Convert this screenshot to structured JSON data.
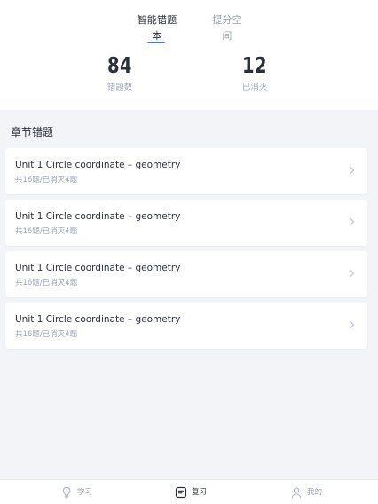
{
  "header": {
    "tabs": [
      {
        "label": "智能错题本",
        "active": true
      },
      {
        "label": "提分空间",
        "active": false
      }
    ],
    "stats": [
      {
        "value": "84",
        "label": "错题数"
      },
      {
        "value": "12",
        "label": "已消灭"
      }
    ]
  },
  "section": {
    "title": "章节错题"
  },
  "items": [
    {
      "title": "Unit 1  Circle coordinate – geometry",
      "subtitle": "共16题/已消灭4题"
    },
    {
      "title": "Unit 1  Circle coordinate – geometry",
      "subtitle": "共16题/已消灭4题"
    },
    {
      "title": "Unit 1  Circle coordinate – geometry",
      "subtitle": "共16题/已消灭4题"
    },
    {
      "title": "Unit 1  Circle coordinate – geometry",
      "subtitle": "共16题/已消灭4题"
    }
  ],
  "bottom_nav": [
    {
      "label": "学习",
      "icon": "lightbulb-icon",
      "active": false
    },
    {
      "label": "复习",
      "icon": "review-book-icon",
      "active": true
    },
    {
      "label": "我的",
      "icon": "user-icon",
      "active": false
    }
  ],
  "colors": {
    "accent": "#4a74f2",
    "background": "#f3f4f8",
    "card": "#ffffff",
    "primary_text": "#2b2f3a",
    "secondary_text": "#9aa1ad"
  }
}
